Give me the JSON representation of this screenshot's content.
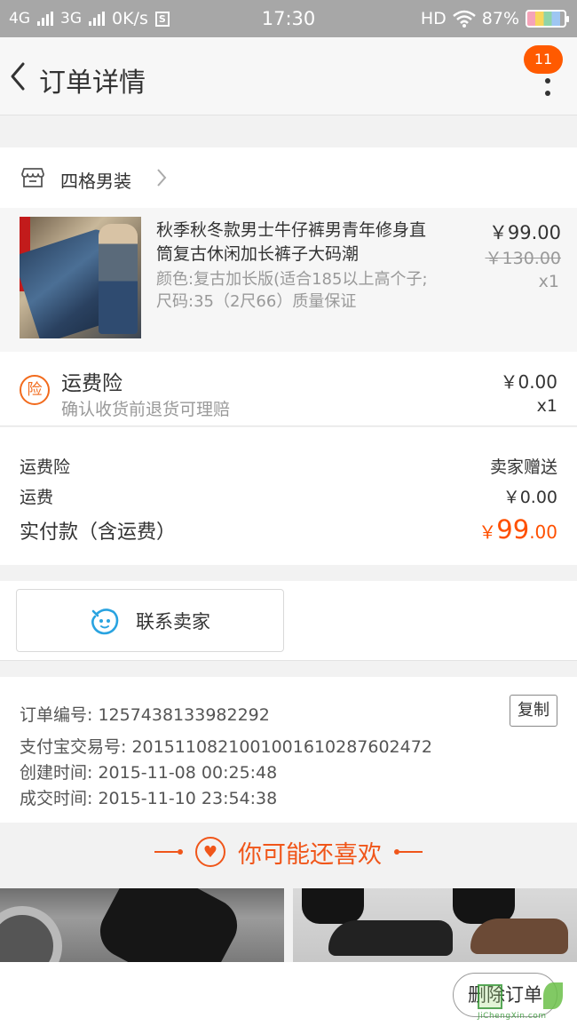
{
  "status_bar": {
    "network_1": "4G",
    "network_2": "3G",
    "speed": "0K/s",
    "download_badge": "S",
    "time": "17:30",
    "hd": "HD",
    "battery": "87%"
  },
  "header": {
    "title": "订单详情",
    "badge_count": "11"
  },
  "shop": {
    "name": "四格男装"
  },
  "product": {
    "title": "秋季秋冬款男士牛仔裤男青年修身直筒复古休闲加长裤子大码潮",
    "spec": "颜色:复古加长版(适合185以上高个子;尺码:35（2尺66）质量保证",
    "price": "￥99.00",
    "original_price": "￥130.00",
    "quantity": "x1"
  },
  "insurance": {
    "icon_text": "险",
    "title": "运费险",
    "description": "确认收货前退货可理赔",
    "price": "￥0.00",
    "quantity": "x1"
  },
  "summary": {
    "rows": [
      {
        "label": "运费险",
        "value": "卖家赠送"
      },
      {
        "label": "运费",
        "value": "￥0.00"
      }
    ],
    "total_label": "实付款（含运费）",
    "total_currency": "￥",
    "total_int": "99",
    "total_dec": ".00"
  },
  "contact": {
    "label": "联系卖家"
  },
  "order_info": {
    "order_no": "订单编号: 1257438133982292",
    "alipay_no": "支付宝交易号: 2015110821001001610287602472",
    "created": "创建时间: 2015-11-08 00:25:48",
    "completed": "成交时间: 2015-11-10 23:54:38",
    "copy_label": "复制"
  },
  "recommend": {
    "title": "你可能还喜欢"
  },
  "bottom": {
    "delete_label": "删除订单"
  },
  "watermark": {
    "text": "JiChengXin.com"
  },
  "colors": {
    "accent": "#ff5000",
    "badge": "#ff5a00",
    "status_bar": "#a7a7a7"
  }
}
